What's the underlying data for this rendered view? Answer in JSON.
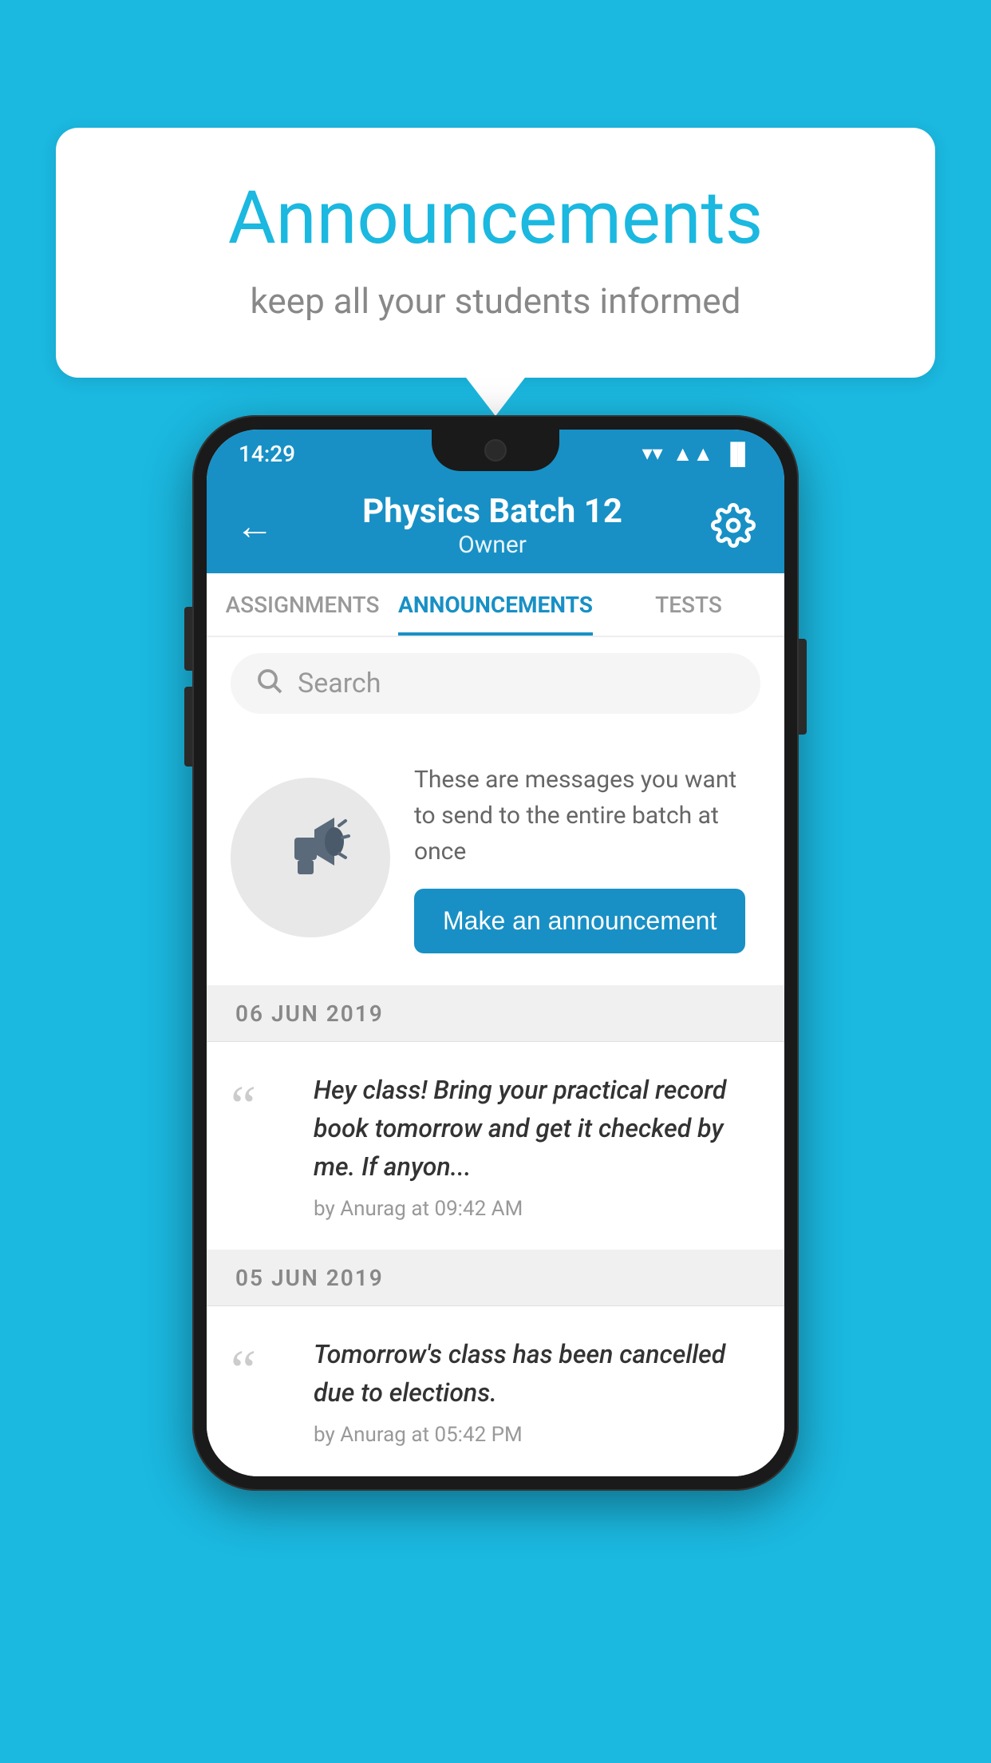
{
  "background_color": "#1BB8E0",
  "speech_bubble": {
    "title": "Announcements",
    "subtitle": "keep all your students informed"
  },
  "phone": {
    "status_bar": {
      "time": "14:29"
    },
    "app_bar": {
      "title": "Physics Batch 12",
      "subtitle": "Owner",
      "back_label": "←"
    },
    "tabs": [
      {
        "label": "ASSIGNMENTS",
        "active": false
      },
      {
        "label": "ANNOUNCEMENTS",
        "active": true
      },
      {
        "label": "TESTS",
        "active": false
      }
    ],
    "search": {
      "placeholder": "Search"
    },
    "promo": {
      "description": "These are messages you want to send to the entire batch at once",
      "button_label": "Make an announcement"
    },
    "announcements": [
      {
        "date": "06  JUN  2019",
        "text": "Hey class! Bring your practical record book tomorrow and get it checked by me. If anyon...",
        "meta": "by Anurag at 09:42 AM"
      },
      {
        "date": "05  JUN  2019",
        "text": "Tomorrow's class has been cancelled due to elections.",
        "meta": "by Anurag at 05:42 PM"
      }
    ]
  }
}
